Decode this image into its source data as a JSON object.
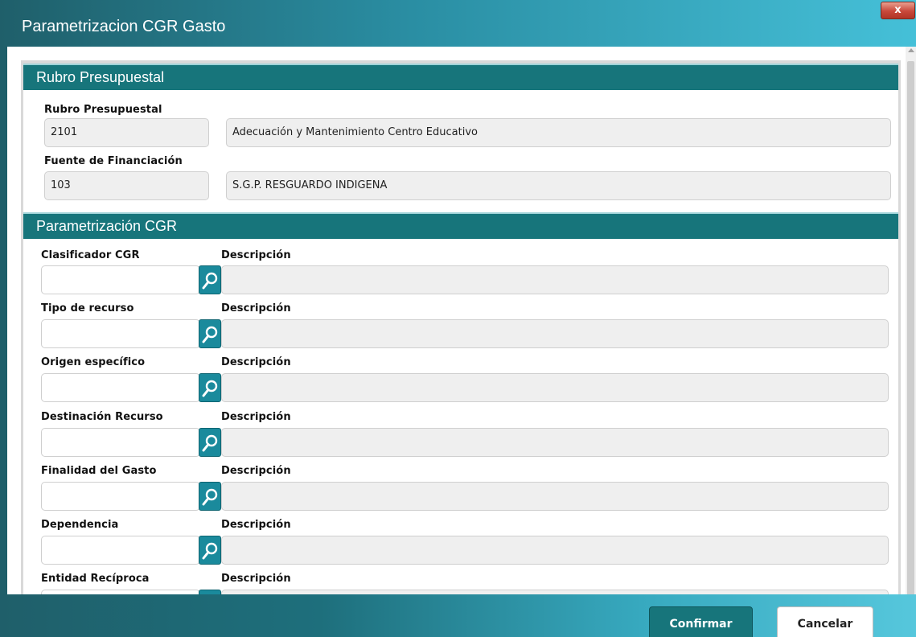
{
  "window": {
    "title": "Parametrizacion CGR Gasto",
    "close_label": "x"
  },
  "rubro_section": {
    "header": "Rubro Presupuestal",
    "rubro": {
      "label": "Rubro Presupuestal",
      "code": "2101",
      "description": "Adecuación y Mantenimiento Centro Educativo"
    },
    "fuente": {
      "label": "Fuente de Financiación",
      "code": "103",
      "description": "S.G.P. RESGUARDO INDIGENA"
    }
  },
  "cgr_section": {
    "header": "Parametrización CGR",
    "rows": [
      {
        "label": "Clasificador CGR",
        "desc_label": "Descripción",
        "value": "",
        "description": ""
      },
      {
        "label": "Tipo de recurso",
        "desc_label": "Descripción",
        "value": "",
        "description": ""
      },
      {
        "label": "Origen específico",
        "desc_label": "Descripción",
        "value": "",
        "description": ""
      },
      {
        "label": "Destinación Recurso",
        "desc_label": "Descripción",
        "value": "",
        "description": ""
      },
      {
        "label": "Finalidad del Gasto",
        "desc_label": "Descripción",
        "value": "",
        "description": ""
      },
      {
        "label": "Dependencia",
        "desc_label": "Descripción",
        "value": "",
        "description": ""
      },
      {
        "label": "Entidad Recíproca",
        "desc_label": "Descripción",
        "value": "",
        "description": ""
      }
    ]
  },
  "footer": {
    "confirm_label": "Confirmar",
    "cancel_label": "Cancelar"
  },
  "icons": {
    "close": "close-icon",
    "search": "search-icon"
  },
  "colors": {
    "header_teal": "#17757b",
    "search_button": "#1a8a9c",
    "field_gray": "#efefef"
  }
}
